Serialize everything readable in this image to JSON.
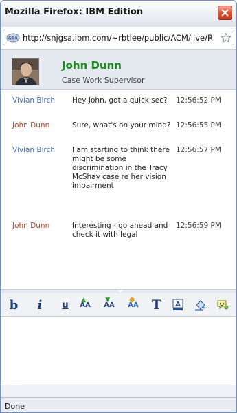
{
  "window": {
    "title": "Mozilla Firefox: IBM Edition"
  },
  "urlbar": {
    "url": "http://snjgsa.ibm.com/~rbtlee/public/ACM/live/R"
  },
  "contact": {
    "name": "John Dunn",
    "title": "Case Work Supervisor"
  },
  "messages": [
    {
      "sender": "Vivian Birch",
      "text": "Hey John, got a quick sec?",
      "time": "12:56:52 PM"
    },
    {
      "sender": "John Dunn",
      "text": "Sure, what's on your mind?",
      "time": "12:56:55 PM"
    },
    {
      "sender": "Vivian Birch",
      "text": "I am starting to think there might be some discrimination in the Tracy McShay case re her vision impairment",
      "time": "12:56:57 PM"
    },
    {
      "sender": "John Dunn",
      "text": "Interesting - go ahead and check it with legal",
      "time": "12:56:59 PM"
    }
  ],
  "toolbar": {
    "bold": "b",
    "italic": "i",
    "underline": "u",
    "grow_font": "AA",
    "shrink_font": "AA",
    "font_color": "AA",
    "font": "T"
  },
  "status": {
    "text": "Done"
  },
  "colors": {
    "contact_name": "#1d8c1d",
    "sender_vivian": "#4169a8",
    "sender_john": "#b5482e",
    "close_button": "#d9502f"
  }
}
